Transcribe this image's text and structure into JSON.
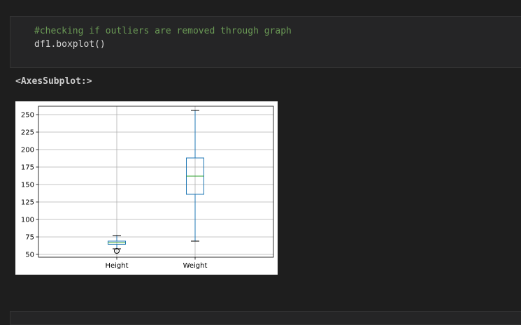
{
  "cell": {
    "comment": "#checking if outliers are removed through graph",
    "code": "df1.boxplot()"
  },
  "output": {
    "repr": "<AxesSubplot:>"
  },
  "chart_data": {
    "type": "boxplot",
    "categories": [
      "Height",
      "Weight"
    ],
    "ylim": [
      46,
      262
    ],
    "yticks": [
      50,
      75,
      100,
      125,
      150,
      175,
      200,
      225,
      250
    ],
    "grid": true,
    "boxes": [
      {
        "name": "Height",
        "whislo": 58,
        "q1": 64.5,
        "med": 66.5,
        "q3": 69,
        "whishi": 77,
        "fliers": [
          55
        ]
      },
      {
        "name": "Weight",
        "whislo": 69,
        "q1": 136,
        "med": 162,
        "q3": 188,
        "whishi": 256,
        "fliers": []
      }
    ],
    "colors": {
      "box": "#1f77b4",
      "median": "#2ca02c",
      "grid": "#b0b0b0"
    }
  }
}
